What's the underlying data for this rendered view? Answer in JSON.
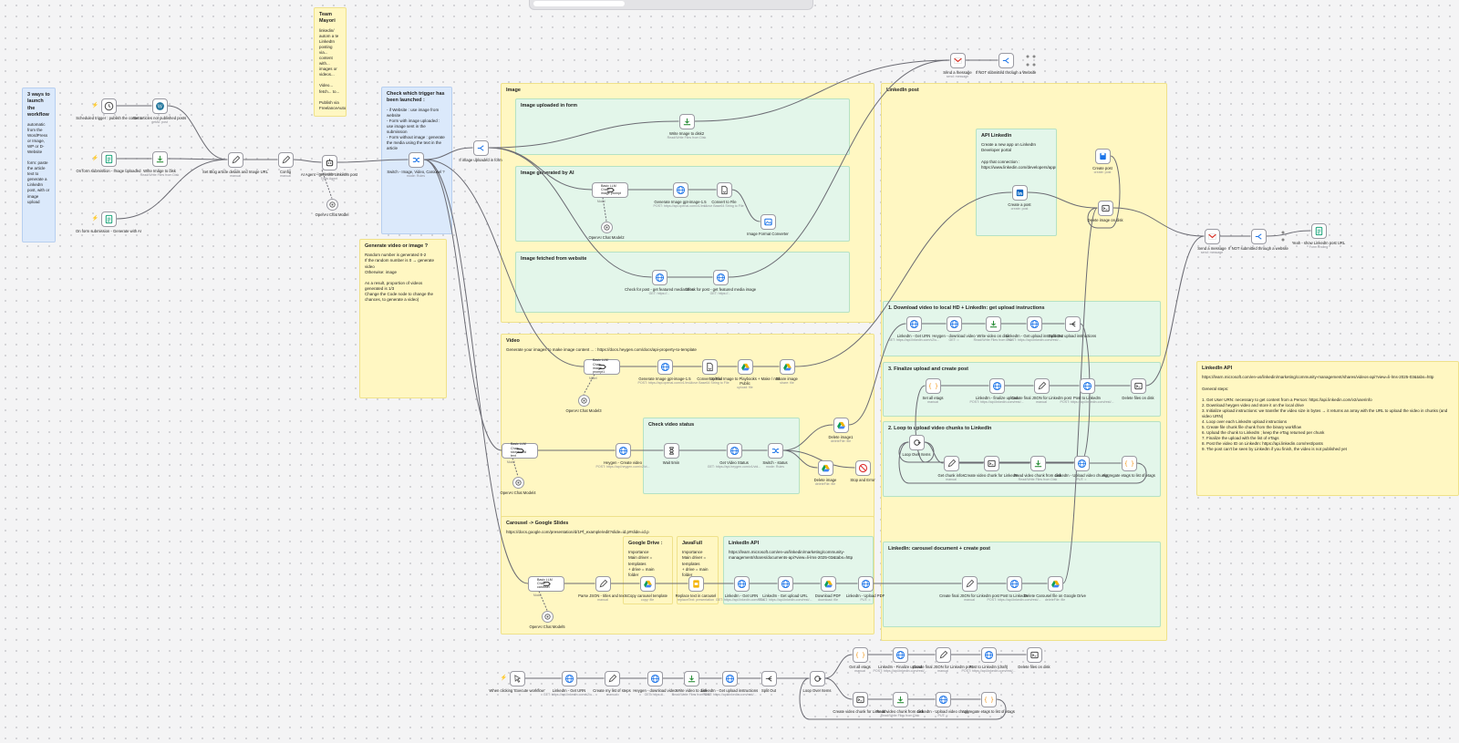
{
  "notes": [
    {
      "title": "3 ways to launch the workflow",
      "body": "automatic from the WordPress or Image, WP or D-Website\n\nform: paste the article text to generate a LinkedIn post, with or image upload"
    },
    {
      "title": "Team Mayori",
      "body": "linkedin/ autom a te LinkedIn posting via... content with... images or videos...\n\nVideo... fetch... to...\n\nPublish via FreelanceAutomat"
    },
    {
      "title": "Check which trigger has been launched :",
      "body": "- if Website : use image from website\n- Form with image uploaded : use image sent in the submission\n- Form without image : generate the media using the text in the article"
    },
    {
      "title": "Generate video or image ?",
      "body": "Random number is generated 0-2\nIf the random number is 0 → generate video\nOtherwise: image\n\nAs a result, proportion of videos generated is 1/3\nChange the Code node to change the chances, to generate a video)"
    },
    {
      "title": "Image",
      "body": ""
    },
    {
      "title": "Image uploaded in form",
      "body": ""
    },
    {
      "title": "Image generated by AI",
      "body": ""
    },
    {
      "title": "Image fetched from website",
      "body": ""
    },
    {
      "title": "Video",
      "body": "Generate your images to make image content ... : https://docs.heygen.com/docs/api-property-to-template"
    },
    {
      "title": "Check video status",
      "body": ""
    },
    {
      "title": "Carousel -> Google Slides",
      "body": "https://docs.google.com/presentation/d/1Pf_example/edit?slide=id.p#slide=id.p"
    },
    {
      "title": "Google Drive :",
      "body": "Importance\nMain driver = templates\n+ drive = main\nfolder"
    },
    {
      "title": "JavaFull",
      "body": "Importance\nMain driver = templates\n+ drive = main\nfolder"
    },
    {
      "title": "LinkedIn API",
      "body": "https://learn.microsoft.com/en-us/linkedin/marketing/community-management/shares/documents-api?view=li-lms-2025-03&tabs=http"
    },
    {
      "title": "LinkedIn post",
      "body": ""
    },
    {
      "title": "API LinkedIn",
      "body": "Create a new app on LinkedIn Developer portal\n\nApp that connection : https://www.linkedin.com/developers/apps/75487889/auth\n\n"
    },
    {
      "title": "1. Download video to local HD + LinkedIn: get upload instructions",
      "body": ""
    },
    {
      "title": "3. Finalize upload and create post",
      "body": ""
    },
    {
      "title": "2. Loop to upload video chunks to LinkedIn",
      "body": ""
    },
    {
      "title": "LinkedIn: carousel document + create post",
      "body": ""
    },
    {
      "title": "LinkedIn API",
      "body": "https://learn.microsoft.com/en-us/linkedin/marketing/community-management/shares/videos-api?view=li-lms-2025-03&tabs=http\n\nGeneral steps:\n\n1. Get User URN: necessary to get content from a Person: https://api.linkedin.com/v2/userinfo\n2. Download heygen video and store it on the local drive\n3. Initialize upload instructions: we transfer the video size in bytes → it returns an array with the URL to upload the video in chunks (and video URN)\n4. Loop over each LinkedIn upload instructions\n5. Create file chunk file chunk from the binary workflow\n6. Upload the chunk to LinkedIn ; keep the eTag returned per chunk\n7. Finalize the upload with the list of eTags\n8. Post the video ID on LinkedIn: https://api.linkedin.com/rest/posts\n9. The post can't be seen by LinkedIn if you finish, the video is not published yet"
    }
  ],
  "nodes": [
    {
      "label": "Scheduled trigger : publish the content",
      "sub": ""
    },
    {
      "label": "Get articles not published posts",
      "sub": "getAll: post"
    },
    {
      "label": "On form submission - Image uploaded",
      "sub": ""
    },
    {
      "label": "Write Image to disk",
      "sub": "Read/Write Files from Disk"
    },
    {
      "label": "On form submission - Generate with AI",
      "sub": ""
    },
    {
      "label": "Set Blog article details and Image URL",
      "sub": "manual"
    },
    {
      "label": "Config",
      "sub": "manual"
    },
    {
      "label": "AI Agent - generate LinkedIn post",
      "sub": "Tools Agent"
    },
    {
      "label": "OpenAI Chat Model",
      "sub": ""
    },
    {
      "label": "Switch - Image, Video, Carousel ?",
      "sub": "mode: Rules"
    },
    {
      "label": "If image uploaded in form",
      "sub": ""
    },
    {
      "label": "Write Image to disk2",
      "sub": "Read/Write Files from Disk"
    },
    {
      "label": "Basic LLM Chain - image prompt",
      "sub": "Chain: Conversation"
    },
    {
      "label": "OpenAI Chat Model2",
      "sub": ""
    },
    {
      "label": "Generate Image gpt-image-1.5",
      "sub": "POST: https://api.openai.com/v1/im..."
    },
    {
      "label": "Convert to File",
      "sub": "Move Base64 String to File"
    },
    {
      "label": "Image Format Converter",
      "sub": ""
    },
    {
      "label": "Check for post - get featured media infos",
      "sub": "GET: https://..."
    },
    {
      "label": "Check for post - get featured media image",
      "sub": "GET: https://..."
    },
    {
      "label": "Basic LLM Chain - image prompt1",
      "sub": "Chain: Conversation"
    },
    {
      "label": "OpenAI Chat Model3",
      "sub": ""
    },
    {
      "label": "Generate Image gpt-image-1.5",
      "sub": "POST: https://api.openai.com/v1/im..."
    },
    {
      "label": "Convert to File",
      "sub": "Move Base64 String to File"
    },
    {
      "label": "Upload Image to Playbooks + Make / n8n Public",
      "sub": "upload: file"
    },
    {
      "label": "Share image",
      "sub": "share: file"
    },
    {
      "label": "Basic LLM Chain - storyboard text",
      "sub": "Chain: Conversation"
    },
    {
      "label": "OpenAI Chat Model4",
      "sub": ""
    },
    {
      "label": "Heygen - Create video",
      "sub": "POST: https://api.heygen.com/v2/vi..."
    },
    {
      "label": "Wait 5min",
      "sub": ""
    },
    {
      "label": "Get Video Status",
      "sub": "GET: https://api.heygen.com/v1/vid..."
    },
    {
      "label": "Switch - status",
      "sub": "mode: Rules"
    },
    {
      "label": "Delete image1",
      "sub": "deleteFile: file"
    },
    {
      "label": "Delete image",
      "sub": "deleteFile: file"
    },
    {
      "label": "Stop and Error",
      "sub": ""
    },
    {
      "label": "Basic LLM Chain - carousel",
      "sub": "Chain: Conversation"
    },
    {
      "label": "OpenAI Chat Model5",
      "sub": ""
    },
    {
      "label": "Parse JSON - titles and texts",
      "sub": "manual"
    },
    {
      "label": "Copy carousel template",
      "sub": "copy: file"
    },
    {
      "label": "Replace text in carousel",
      "sub": "replaceText: presentation"
    },
    {
      "label": "LinkedIn - Get URN",
      "sub": "GET: https://api.linkedin.com/v2/u..."
    },
    {
      "label": "LinkedIn - Get upload URL",
      "sub": "POST: https://api.linkedin.com/rest/..."
    },
    {
      "label": "Download PDF",
      "sub": "download: file"
    },
    {
      "label": "LinkedIn - Upload PDF",
      "sub": "PUT: ="
    },
    {
      "label": "Create final JSON for LinkedIn post",
      "sub": "manual"
    },
    {
      "label": "Post to LinkedIn",
      "sub": "POST: https://api.linkedin.com/rest/..."
    },
    {
      "label": "Delete Carousel file on Google Drive",
      "sub": "deleteFile: file"
    },
    {
      "label": "Send a message",
      "sub": "send: message"
    },
    {
      "label": "If NOT submitted through a Website",
      "sub": ""
    },
    {
      "label": "Create a post",
      "sub": "create: post"
    },
    {
      "label": "Create post",
      "sub": "create: post"
    },
    {
      "label": "Delete image on disk",
      "sub": ""
    },
    {
      "label": "Send a message",
      "sub": "send: message"
    },
    {
      "label": "If NOT submitted through a website",
      "sub": ""
    },
    {
      "label": "Yeah - show LinkedIn post URL",
      "sub": "Form Ending"
    },
    {
      "label": "LinkedIn - Get URN",
      "sub": "GET: https://api.linkedin.com/v2/u..."
    },
    {
      "label": "Heygen - download video",
      "sub": "GET: ="
    },
    {
      "label": "Write video on disk",
      "sub": "Read/Write Files from Disk"
    },
    {
      "label": "LinkedIn - Get upload instructions",
      "sub": "POST: https://api.linkedin.com/rest/..."
    },
    {
      "label": "Split Out upload instructions",
      "sub": ""
    },
    {
      "label": "Set all etags",
      "sub": "manual"
    },
    {
      "label": "LinkedIn - finalize upload",
      "sub": "POST: https://api.linkedin.com/rest/..."
    },
    {
      "label": "Create final JSON for LinkedIn post",
      "sub": "manual"
    },
    {
      "label": "Post to LinkedIn",
      "sub": "POST: https://api.linkedin.com/rest/..."
    },
    {
      "label": "Delete files on disk",
      "sub": ""
    },
    {
      "label": "Loop Over Items",
      "sub": ""
    },
    {
      "label": "Get chunk infos",
      "sub": "manual"
    },
    {
      "label": "Create video chunk for LinkedIn",
      "sub": ""
    },
    {
      "label": "Read video chunk from disk",
      "sub": "Read/Write Files from Disk"
    },
    {
      "label": "LinkedIn - Upload video chunks",
      "sub": "PUT: ="
    },
    {
      "label": "Aggregate etags to list of etags",
      "sub": ""
    },
    {
      "label": "When clicking 'Execute workflow'",
      "sub": ""
    },
    {
      "label": "LinkedIn - Get URN",
      "sub": "GET: https://api.linkedin.com/v2/u..."
    },
    {
      "label": "Create my list of steps",
      "sub": "manual"
    },
    {
      "label": "Heygen - download video",
      "sub": "GET: https://..."
    },
    {
      "label": "Write video to disk",
      "sub": "Read/Write Files from Disk"
    },
    {
      "label": "LinkedIn - Get upload instructions",
      "sub": "POST: https://api.linkedin.com/rest/..."
    },
    {
      "label": "Split Out",
      "sub": ""
    },
    {
      "label": "Loop Over Items",
      "sub": ""
    },
    {
      "label": "Get all etags",
      "sub": "manual"
    },
    {
      "label": "LinkedIn - Finalize upload",
      "sub": "POST: https://api.linkedin.com/rest/..."
    },
    {
      "label": "Create final JSON for LinkedIn post",
      "sub": "manual"
    },
    {
      "label": "Post to LinkedIn (draft)",
      "sub": "POST: https://api.linkedin.com/rest/..."
    },
    {
      "label": "Delete files on disk",
      "sub": ""
    },
    {
      "label": "Create video chunk for LinkedIn",
      "sub": ""
    },
    {
      "label": "Read video chunk from disk",
      "sub": "Read/Write Files from Disk"
    },
    {
      "label": "LinkedIn - Upload video chunk",
      "sub": "PUT: ="
    },
    {
      "label": "Aggregate etags to list of etags",
      "sub": ""
    }
  ],
  "ports": {
    "chat_model": "Chat Model*",
    "memory": "Memory",
    "tool": "Tool",
    "model": "Model"
  },
  "colors": {
    "canvas": "#f4f4f5",
    "sticky_yellow": "#fff7c2",
    "sticky_blue": "#dbe9fb",
    "sticky_green": "#e3f6ea",
    "edge": "#6b6b73",
    "trigger": "#ff6d5a"
  }
}
